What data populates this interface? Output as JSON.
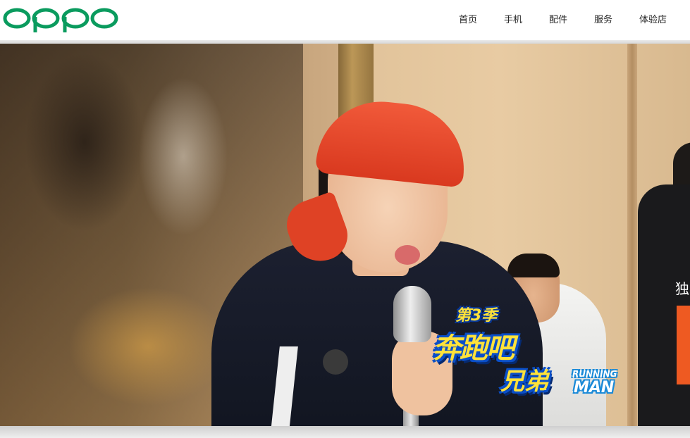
{
  "header": {
    "logo_text": "oppo",
    "brand_color": "#0a9b5e",
    "nav": [
      {
        "label": "首页"
      },
      {
        "label": "手机"
      },
      {
        "label": "配件"
      },
      {
        "label": "服务"
      },
      {
        "label": "体验店"
      }
    ]
  },
  "banner": {
    "show_logo": {
      "season": "第3季",
      "title_line1": "奔跑吧",
      "title_line2": "兄弟",
      "english_line1": "RUNNING",
      "english_line2": "MAN"
    },
    "side_text": "独",
    "side_tab_color": "#ee5a22"
  }
}
